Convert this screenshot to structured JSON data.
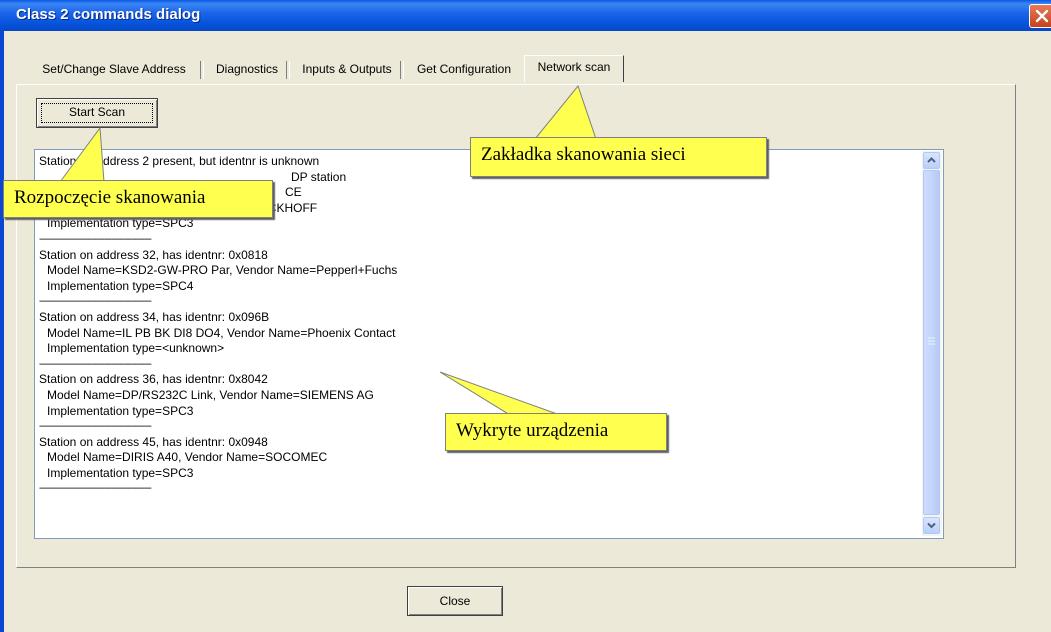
{
  "window": {
    "title": "Class 2 commands dialog"
  },
  "tabs": [
    {
      "label": "Set/Change Slave Address",
      "active": false
    },
    {
      "label": "Diagnostics",
      "active": false
    },
    {
      "label": "Inputs & Outputs",
      "active": false
    },
    {
      "label": "Get Configuration",
      "active": false
    },
    {
      "label": "Network scan",
      "active": true
    }
  ],
  "toolbar": {
    "start_scan_label": "Start Scan"
  },
  "results": {
    "lines": [
      "Station on address 2 present, but identnr is unknown",
      "DP station",
      "CE",
      "Model Name=BK3150, Vendor Name=BECKHOFF",
      "Implementation type=SPC3",
      "------------------------------------------------",
      "Station on address 32, has identnr: 0x0818",
      "Model Name=KSD2-GW-PRO Par, Vendor Name=Pepperl+Fuchs",
      "Implementation type=SPC4",
      "------------------------------------------------",
      "Station on address 34, has identnr: 0x096B",
      "Model Name=IL PB BK DI8 DO4, Vendor Name=Phoenix Contact",
      "Implementation type=<unknown>",
      "------------------------------------------------",
      "Station on address 36, has identnr: 0x8042",
      "Model Name=DP/RS232C Link, Vendor Name=SIEMENS AG",
      "Implementation type=SPC3",
      "------------------------------------------------",
      "Station on address 45, has identnr: 0x0948",
      "Model Name=DIRIS A40, Vendor Name=SOCOMEC",
      "Implementation type=SPC3",
      "------------------------------------------------"
    ]
  },
  "footer": {
    "close_label": "Close"
  },
  "callouts": {
    "start_scan": "Rozpoczęcie skanowania",
    "network_tab": "Zakładka skanowania sieci",
    "devices": "Wykryte urządzenia"
  },
  "icons": {
    "close": "close-icon",
    "scroll_up": "chevron-up-icon",
    "scroll_down": "chevron-down-icon"
  },
  "colors": {
    "titlebar": "#0654dc",
    "callout_bg": "#ffff50",
    "close_button": "#c6401a"
  }
}
